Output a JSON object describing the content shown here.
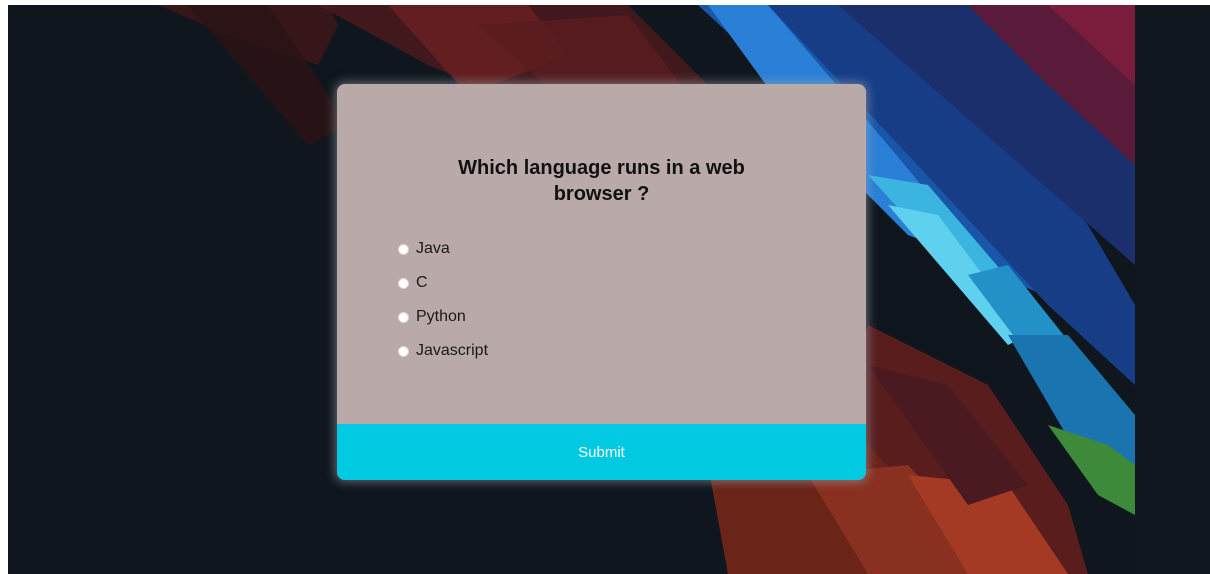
{
  "quiz": {
    "question_line1": "Which language runs in a web",
    "question_line2": "browser ?",
    "answers": [
      {
        "label": "Java",
        "selected": false
      },
      {
        "label": "C",
        "selected": false
      },
      {
        "label": "Python",
        "selected": false
      },
      {
        "label": "Javascript",
        "selected": false
      }
    ],
    "submit_label": "Submit"
  },
  "theme": {
    "background": "#0f161d",
    "card": "#baa9a9",
    "submit": "#02c9e2",
    "text": "#111111"
  }
}
